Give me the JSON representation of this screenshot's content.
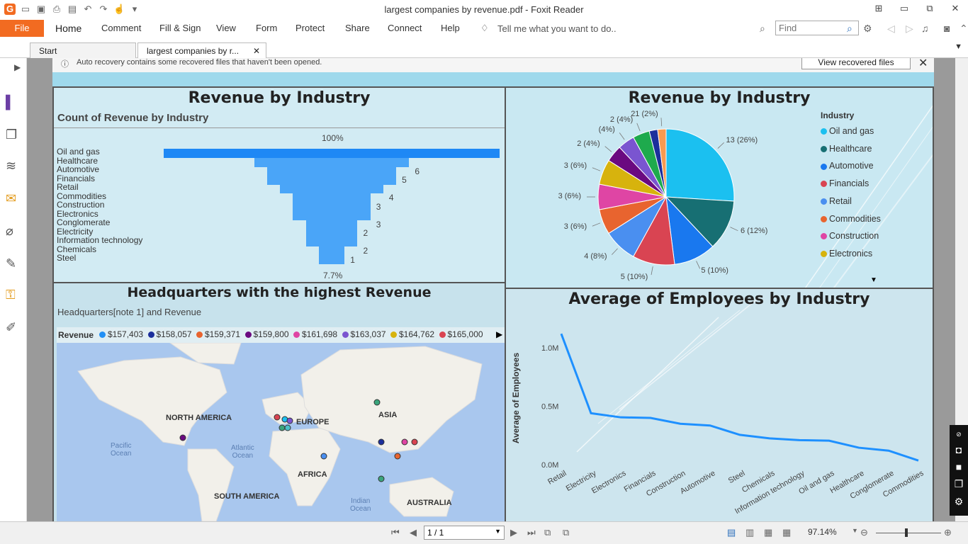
{
  "app": {
    "window_title": "largest companies by revenue.pdf - Foxit Reader",
    "colors": {
      "accent": "#f26b21",
      "banner": "#9fd9ec",
      "panel_bg": "#d6ecf3"
    }
  },
  "menu": {
    "file": "File",
    "items": [
      "Home",
      "Comment",
      "Fill & Sign",
      "View",
      "Form",
      "Protect",
      "Share",
      "Connect",
      "Help"
    ],
    "tell_me": "Tell me what you want to do..",
    "find_placeholder": "Find"
  },
  "tabs": [
    {
      "label": "Start"
    },
    {
      "label": "largest companies by r...",
      "close": "✕"
    }
  ],
  "banner": {
    "text": "Auto recovery contains some recovered files that haven't been opened.",
    "button": "View recovered files",
    "close": "✕"
  },
  "funnel_panel": {
    "title": "Revenue by Industry",
    "subtitle": "Count of Revenue by Industry",
    "top_pct": "100%",
    "bottom_pct": "7.7%"
  },
  "pie_panel": {
    "title": "Revenue by Industry",
    "legend_title": "Industry",
    "legend": [
      {
        "name": "Oil and gas",
        "color": "#1bc0f0"
      },
      {
        "name": "Healthcare",
        "color": "#176f73"
      },
      {
        "name": "Automotive",
        "color": "#1978ef"
      },
      {
        "name": "Financials",
        "color": "#d94452"
      },
      {
        "name": "Retail",
        "color": "#4a8ff0"
      },
      {
        "name": "Commodities",
        "color": "#e8642f"
      },
      {
        "name": "Construction",
        "color": "#df45a4"
      },
      {
        "name": "Electronics",
        "color": "#d7b30d"
      }
    ]
  },
  "map_panel": {
    "title": "Headquarters with the highest Revenue",
    "subtitle": "Headquarters[note 1] and Revenue",
    "legend_label": "Revenue",
    "legend": [
      {
        "value": "$157,403",
        "color": "#2290f5"
      },
      {
        "value": "$158,057",
        "color": "#1c2f9c"
      },
      {
        "value": "$159,371",
        "color": "#e8642f"
      },
      {
        "value": "$159,800",
        "color": "#6b0a80"
      },
      {
        "value": "$161,698",
        "color": "#df45a4"
      },
      {
        "value": "$163,037",
        "color": "#7a55d0"
      },
      {
        "value": "$164,762",
        "color": "#d7b30d"
      },
      {
        "value": "$165,000",
        "color": "#d94452"
      }
    ],
    "regions": [
      "NORTH AMERICA",
      "EUROPE",
      "ASIA",
      "AFRICA",
      "SOUTH AMERICA",
      "AUSTRALIA"
    ],
    "oceans": [
      "Pacific\nOcean",
      "Atlantic\nOcean",
      "Indian\nOcean"
    ]
  },
  "employees_panel": {
    "title": "Average of Employees by Industry"
  },
  "bottom": {
    "page": "1 / 1",
    "zoom": "97.14%"
  },
  "chart_data": [
    {
      "type": "funnel",
      "title": "Revenue by Industry",
      "subtitle": "Count of Revenue by Industry",
      "categories": [
        "Oil and gas",
        "Healthcare",
        "Automotive",
        "Financials",
        "Retail",
        "Commodities",
        "Construction",
        "Electronics",
        "Conglomerate",
        "Electricity",
        "Information technology",
        "Chemicals",
        "Steel"
      ],
      "values": [
        13,
        6,
        5,
        5,
        4,
        3,
        3,
        3,
        2,
        2,
        2,
        1,
        1
      ],
      "value_labels": [
        "",
        "6",
        "5",
        "",
        "4",
        "3",
        "",
        "3",
        "2",
        "",
        "2",
        "1",
        ""
      ],
      "top_label": "100%",
      "bottom_label": "7.7%"
    },
    {
      "type": "pie",
      "title": "Revenue by Industry",
      "legend_title": "Industry",
      "categories": [
        "Oil and gas",
        "Healthcare",
        "Automotive",
        "Financials",
        "Retail",
        "Commodities",
        "Construction",
        "Electronics",
        "Conglomerate",
        "Electricity",
        "Information technology",
        "Chemicals",
        "Steel"
      ],
      "values": [
        13,
        6,
        5,
        5,
        4,
        3,
        3,
        3,
        2,
        2,
        2,
        1,
        1
      ],
      "colors": [
        "#1bc0f0",
        "#176f73",
        "#1978ef",
        "#d94452",
        "#4a8ff0",
        "#e8642f",
        "#df45a4",
        "#d7b30d",
        "#6b0a80",
        "#7a55d0",
        "#1eaa4d",
        "#1c2f9c",
        "#f79a4f"
      ],
      "labels": [
        "13 (26%)",
        "6 (12%)",
        "5 (10%)",
        "5 (10%)",
        "4 (8%)",
        "3 (6%)",
        "3 (6%)",
        "3 (6%)",
        "2 (4%)",
        "(4%)",
        "2 (4%)",
        "",
        "21 (2%)"
      ],
      "legend_placement": "right"
    },
    {
      "type": "line",
      "title": "Average of Employees by Industry",
      "ylabel": "Average of Employees",
      "categories": [
        "Retail",
        "Electricity",
        "Electronics",
        "Financials",
        "Construction",
        "Automotive",
        "Steel",
        "Chemicals",
        "Information technology",
        "Oil and gas",
        "Healthcare",
        "Conglomerate",
        "Commodities"
      ],
      "values": [
        1120000,
        440000,
        405000,
        400000,
        350000,
        335000,
        255000,
        225000,
        210000,
        205000,
        145000,
        120000,
        35000
      ],
      "yticks": [
        "0.0M",
        "0.5M",
        "1.0M"
      ],
      "ylim": [
        0,
        1200000
      ],
      "color": "#1e90ff"
    }
  ]
}
